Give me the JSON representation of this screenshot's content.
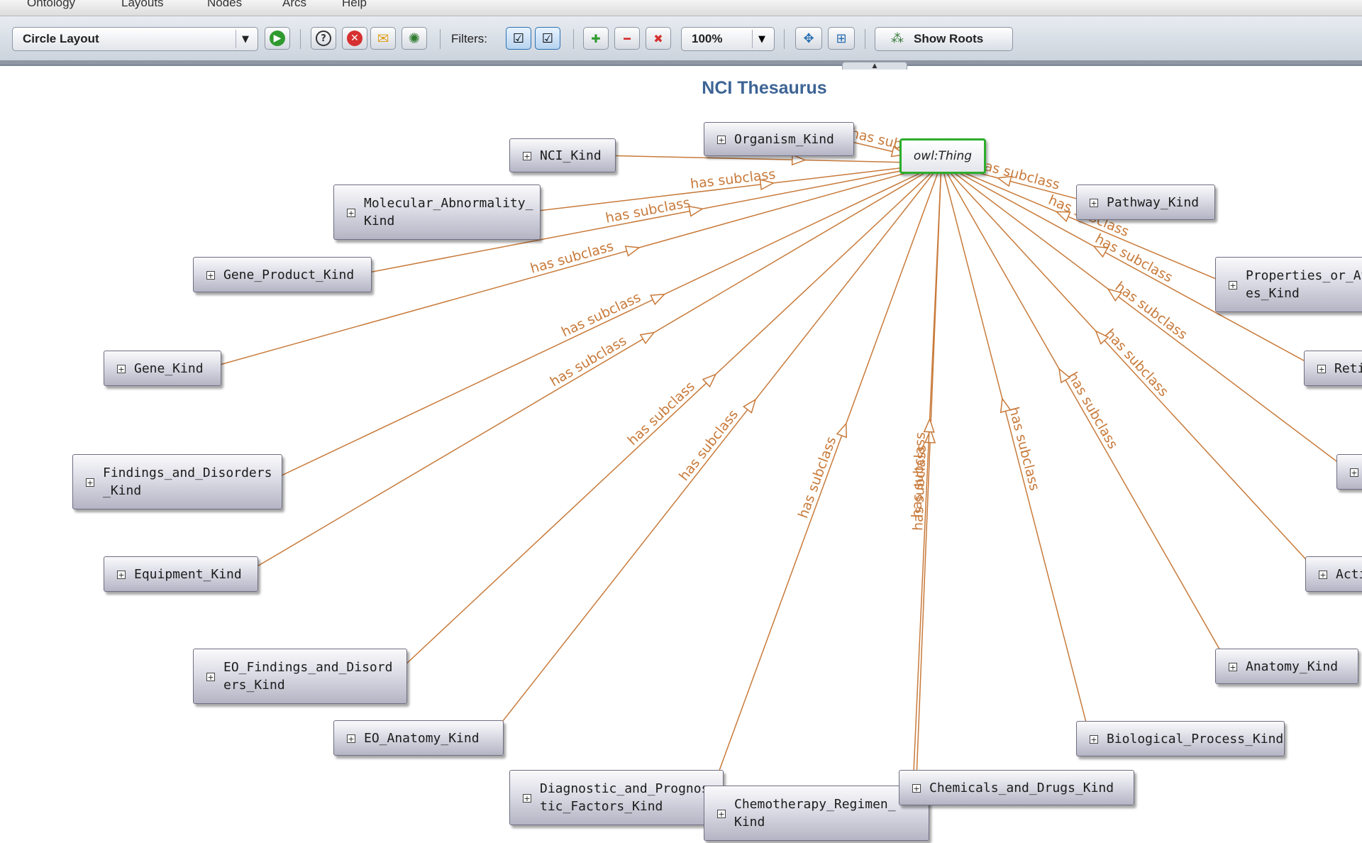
{
  "menu": [
    "Ontology",
    "Layouts",
    "Nodes",
    "Arcs",
    "Help"
  ],
  "toolbar": {
    "layout_select": "Circle Layout",
    "filters_label": "Filters:",
    "zoom_value": "100%",
    "show_roots_label": "Show Roots",
    "icons": [
      "play-icon",
      "help-icon",
      "stop-icon",
      "email-icon",
      "debug-icon",
      "filter-nodes-icon",
      "filter-arcs-icon",
      "add-node-icon",
      "remove-node-icon",
      "remove-all-icon",
      "zoom-icon",
      "fit-icon",
      "expand-icon",
      "show-roots-icon"
    ]
  },
  "graph": {
    "title": "NCI Thesaurus",
    "root": "owl:Thing",
    "arc_label": "has subclass",
    "nodes": [
      {
        "id": "organism",
        "line1": "Organism_Kind",
        "line2": ""
      },
      {
        "id": "nci",
        "line1": "NCI_Kind",
        "line2": ""
      },
      {
        "id": "molecular",
        "line1": "Molecular_Abnormality_",
        "line2": "Kind"
      },
      {
        "id": "geneproduct",
        "line1": "Gene_Product_Kind",
        "line2": ""
      },
      {
        "id": "gene",
        "line1": "Gene_Kind",
        "line2": ""
      },
      {
        "id": "findings",
        "line1": "Findings_and_Disorders",
        "line2": "_Kind"
      },
      {
        "id": "equipment",
        "line1": "Equipment_Kind",
        "line2": ""
      },
      {
        "id": "eofindings",
        "line1": "EO_Findings_and_Disord",
        "line2": "ers_Kind"
      },
      {
        "id": "eoanatomy",
        "line1": "EO_Anatomy_Kind",
        "line2": ""
      },
      {
        "id": "diagnostic",
        "line1": "Diagnostic_and_Prognos",
        "line2": "tic_Factors_Kind"
      },
      {
        "id": "chemo",
        "line1": "Chemotherapy_Regimen_",
        "line2": "Kind"
      },
      {
        "id": "chemicals",
        "line1": "Chemicals_and_Drugs_Kind",
        "line2": ""
      },
      {
        "id": "bioprocess",
        "line1": "Biological_Process_Kind",
        "line2": ""
      },
      {
        "id": "anatomy",
        "line1": "Anatomy_Kind",
        "line2": ""
      },
      {
        "id": "activity",
        "line1": "Activ",
        "line2": ""
      },
      {
        "id": "unnamed",
        "line1": "",
        "line2": ""
      },
      {
        "id": "retired",
        "line1": "Reti",
        "line2": ""
      },
      {
        "id": "properties",
        "line1": "Properties_or_At",
        "line2": "es_Kind"
      },
      {
        "id": "pathway",
        "line1": "Pathway_Kind",
        "line2": ""
      }
    ]
  },
  "colors": {
    "arc": "#c87a3a",
    "root_border": "#2cae2c",
    "title": "#3d6495"
  }
}
